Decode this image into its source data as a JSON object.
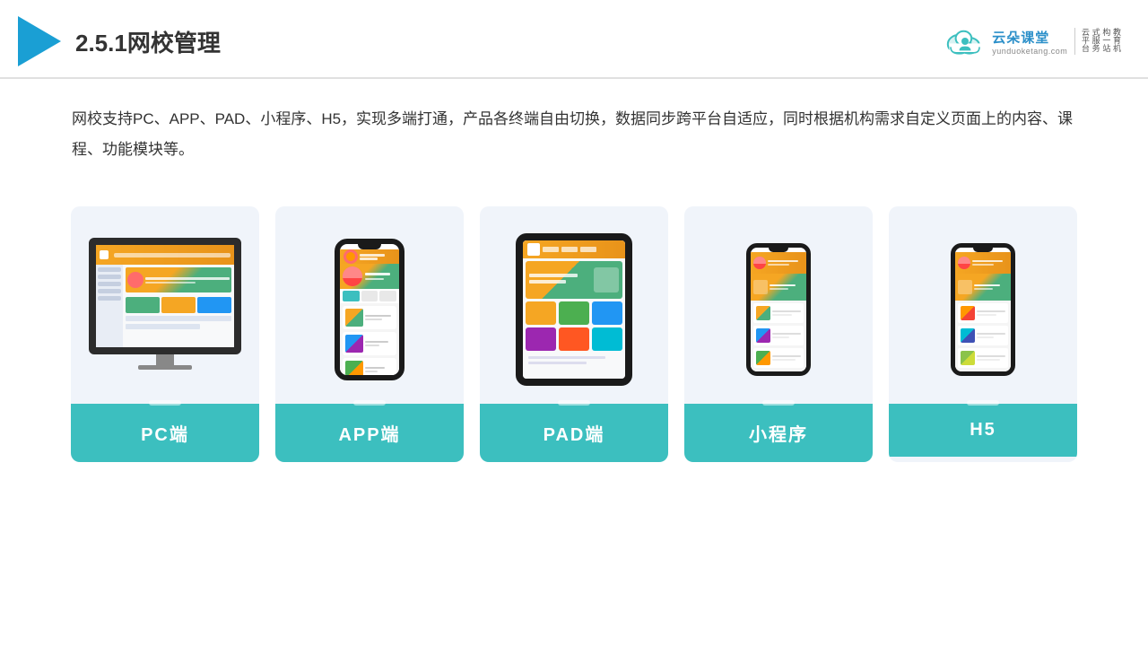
{
  "header": {
    "title": "2.5.1网校管理",
    "brand": {
      "name": "云朵课堂",
      "url": "yunduoketang.com",
      "slogan": "教育机构一站式服务云平台"
    }
  },
  "description": "网校支持PC、APP、PAD、小程序、H5，实现多端打通，产品各终端自由切换，数据同步跨平台自适应，同时根据机构需求自定义页面上的内容、课程、功能模块等。",
  "cards": [
    {
      "id": "pc",
      "label": "PC端"
    },
    {
      "id": "app",
      "label": "APP端"
    },
    {
      "id": "pad",
      "label": "PAD端"
    },
    {
      "id": "miniprogram",
      "label": "小程序"
    },
    {
      "id": "h5",
      "label": "H5"
    }
  ]
}
